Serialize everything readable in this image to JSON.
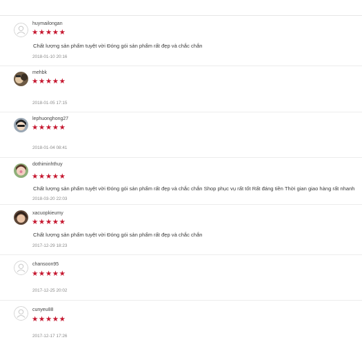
{
  "reviews": [
    {
      "username": "huymailongan",
      "avatar": "default-user-icon",
      "rating": 5,
      "stars": "★★★★★",
      "comment": "Chất lượng sản phẩm tuyệt vời Đóng gói sản phẩm rất đẹp và chắc chắn",
      "date": "2018-01-10 20:16"
    },
    {
      "username": "mehbk",
      "avatar": "user-photo",
      "rating": 5,
      "stars": "★★★★★",
      "comment": "",
      "date": "2018-01-05 17:15"
    },
    {
      "username": "lephuonghong27",
      "avatar": "user-photo",
      "rating": 5,
      "stars": "★★★★★",
      "comment": "",
      "date": "2018-01-04 08:41"
    },
    {
      "username": "dothiminhthuy",
      "avatar": "user-photo",
      "rating": 5,
      "stars": "★★★★★",
      "comment": "Chất lượng sản phẩm tuyệt vời Đóng gói sản phẩm rất đẹp và chắc chắn Shop phục vụ rất tốt Rất đáng tiền Thời gian giao hàng rất nhanh",
      "date": "2018-03-20 22:03"
    },
    {
      "username": "xacuopkieumy",
      "avatar": "user-photo",
      "rating": 5,
      "stars": "★★★★★",
      "comment": "Chất lượng sản phẩm tuyệt vời Đóng gói sản phẩm rất đẹp và chắc chắn",
      "date": "2017-12-29 18:23"
    },
    {
      "username": "chansoon95",
      "avatar": "default-user-icon",
      "rating": 5,
      "stars": "★★★★★",
      "comment": "",
      "date": "2017-12-25 20:02"
    },
    {
      "username": "cunyeu88",
      "avatar": "default-user-icon",
      "rating": 5,
      "stars": "★★★★★",
      "comment": "",
      "date": "2017-12-17 17:26"
    }
  ],
  "colors": {
    "star": "#c5162e",
    "divider": "#ececec"
  }
}
